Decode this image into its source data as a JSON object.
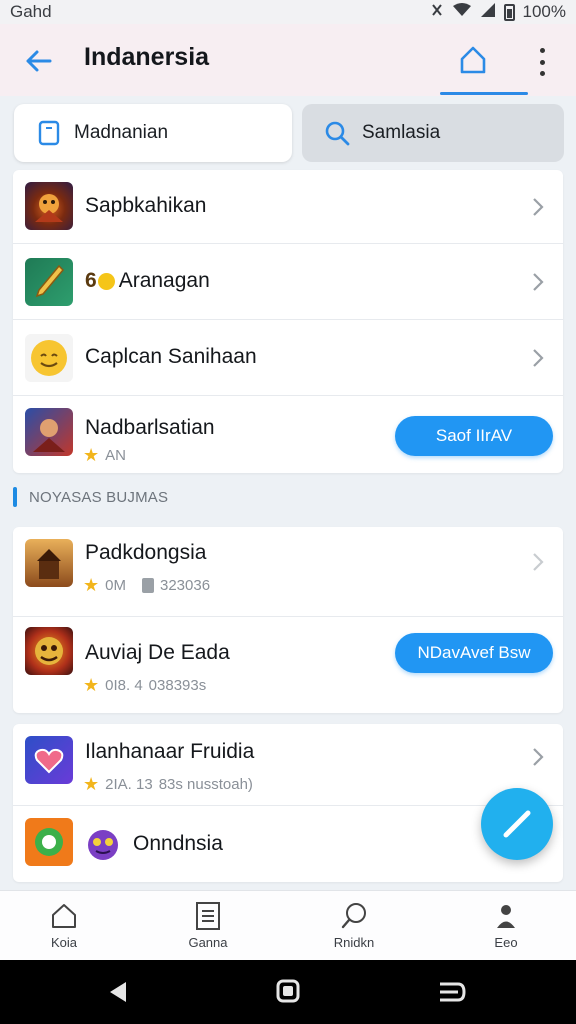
{
  "status_bar": {
    "carrier": "Gahd",
    "battery": "100%"
  },
  "app_bar": {
    "title": "Indanersia"
  },
  "tabs": [
    {
      "label": "Madnanian",
      "icon": "tablet-icon"
    },
    {
      "label": "Samlasia",
      "icon": "search-icon"
    }
  ],
  "list1": [
    {
      "title": "Sapbkahikan",
      "icon": "game-warrior-icon"
    },
    {
      "title": "Aranagan",
      "prefix": "6",
      "icon": "sword-icon"
    },
    {
      "title": "Caplcan Sanihaan",
      "icon": "smiley-emoji-icon"
    },
    {
      "title": "Nadbarlsatian",
      "rating": "AN",
      "button": "Saof IIrAV",
      "icon": "game-hero-icon"
    }
  ],
  "section_label": "NOYASAS BUJMAS",
  "list2": [
    {
      "title": "Padkdongsia",
      "rating": "0M",
      "size": "323036",
      "icon": "castle-game-icon"
    },
    {
      "title": "Auviaj De Eada",
      "rating": "0I8. 4",
      "size": "038393s",
      "button": "NDavAvef Bsw",
      "icon": "monster-game-icon"
    }
  ],
  "list3": [
    {
      "title": "Ilanhanaar Fruidia",
      "rating": "2IA. 13",
      "extra": "83s nusstoah)",
      "icon": "heart-app-icon"
    },
    {
      "title": "Onndnsia",
      "icon": "chat-app-icon"
    }
  ],
  "bottom_nav": [
    {
      "label": "Koia",
      "icon": "home-icon"
    },
    {
      "label": "Ganna",
      "icon": "document-icon"
    },
    {
      "label": "Rnidkn",
      "icon": "search-person-icon"
    },
    {
      "label": "Eeo",
      "icon": "profile-icon"
    }
  ],
  "colors": {
    "accent": "#2196f3",
    "fab": "#21b0ee",
    "appbar": "#f7eef2",
    "star": "#f2b51c"
  }
}
